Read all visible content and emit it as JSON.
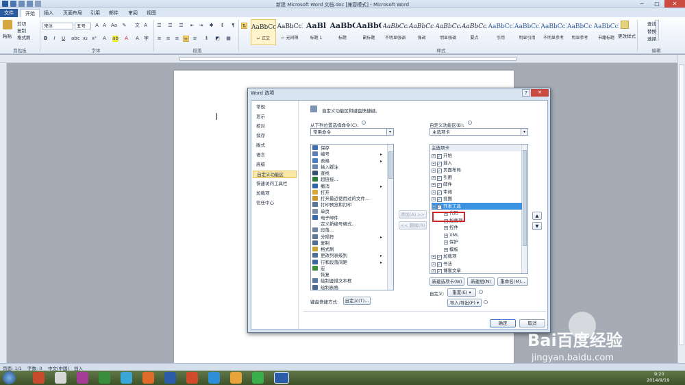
{
  "window": {
    "title": "新建 Microsoft Word 文档.doc [兼容模式] - Microsoft Word"
  },
  "tabs": [
    "文件",
    "开始",
    "插入",
    "页面布局",
    "引用",
    "邮件",
    "审阅",
    "视图"
  ],
  "ribbon": {
    "clipboard": {
      "paste": "粘贴",
      "cut": "剪切",
      "copy": "复制",
      "format_painter": "格式刷",
      "label": "剪贴板"
    },
    "font": {
      "name": "宋体",
      "size": "五号",
      "label": "字体"
    },
    "paragraph": {
      "label": "段落"
    },
    "styles": {
      "label": "样式",
      "items": [
        {
          "sample": "AaBbCcDc",
          "name": "↵ 正文"
        },
        {
          "sample": "AaBbCcDc",
          "name": "↵ 无间隔"
        },
        {
          "sample": "AaBl",
          "name": "标题 1"
        },
        {
          "sample": "AaBbC",
          "name": "标题"
        },
        {
          "sample": "AaBbC",
          "name": "副标题"
        },
        {
          "sample": "AaBbCcDc",
          "name": "不明显强调"
        },
        {
          "sample": "AaBbCcDc",
          "name": "强调"
        },
        {
          "sample": "AaBbCcDc",
          "name": "明显强调"
        },
        {
          "sample": "AaBbCcDc",
          "name": "要点"
        },
        {
          "sample": "AaBbCcDc",
          "name": "引用"
        },
        {
          "sample": "AaBbCcDc",
          "name": "明显引用"
        },
        {
          "sample": "AaBbCcDc",
          "name": "不明显参考"
        },
        {
          "sample": "AaBbCcDc",
          "name": "明显参考"
        },
        {
          "sample": "AaBbCcI",
          "name": "书籍标题"
        }
      ],
      "change_styles": "更改样式"
    },
    "editing": {
      "find": "查找",
      "replace": "替换",
      "select": "选择",
      "label": "编辑"
    }
  },
  "dialog": {
    "title": "Word 选项",
    "help": "?",
    "close": "✕",
    "nav": [
      "常规",
      "显示",
      "校对",
      "保存",
      "版式",
      "语言",
      "高级",
      "自定义功能区",
      "快速访问工具栏",
      "加载项",
      "信任中心"
    ],
    "header": "自定义功能区和键盘快捷键。",
    "left_label": "从下列位置选择命令(C):",
    "left_dropdown": "常用命令",
    "commands": [
      {
        "label": "保存",
        "color": "#3e6db0",
        "sub": ""
      },
      {
        "label": "编号",
        "color": "#5b7fb4",
        "sub": "▸"
      },
      {
        "label": "表格",
        "color": "#4a7cc0",
        "sub": "▸"
      },
      {
        "label": "插入脚注",
        "color": "#6a86ad",
        "sub": ""
      },
      {
        "label": "查找",
        "color": "#37506f",
        "sub": ""
      },
      {
        "label": "超链接...",
        "color": "#2d7a3c",
        "sub": ""
      },
      {
        "label": "撤消",
        "color": "#2f61a7",
        "sub": "▸"
      },
      {
        "label": "打开",
        "color": "#d6a93c",
        "sub": ""
      },
      {
        "label": "打开最近使用过的文件...",
        "color": "#c9972e",
        "sub": ""
      },
      {
        "label": "打印预览和打印",
        "color": "#5b7594",
        "sub": ""
      },
      {
        "label": "单页",
        "color": "#7a8ea6",
        "sub": ""
      },
      {
        "label": "电子邮件",
        "color": "#3b6aa8",
        "sub": ""
      },
      {
        "label": "定义新编号格式...",
        "color": "#ffffff",
        "sub": ""
      },
      {
        "label": "段落...",
        "color": "#6f85a0",
        "sub": ""
      },
      {
        "label": "分隔符",
        "color": "#5e7792",
        "sub": "▸"
      },
      {
        "label": "复制",
        "color": "#4f6c93",
        "sub": ""
      },
      {
        "label": "格式刷",
        "color": "#c8a435",
        "sub": ""
      },
      {
        "label": "更改列表级别",
        "color": "#4e6d97",
        "sub": "▸"
      },
      {
        "label": "行和段落间距",
        "color": "#3f65a0",
        "sub": "▸"
      },
      {
        "label": "宏",
        "color": "#3f8c3a",
        "sub": ""
      },
      {
        "label": "恢复",
        "color": "#ffffff",
        "sub": ""
      },
      {
        "label": "绘制竖排文本框",
        "color": "#5c79a2",
        "sub": ""
      },
      {
        "label": "绘制表格",
        "color": "#4d6b92",
        "sub": ""
      }
    ],
    "add_button": "添加(A) >>",
    "remove_button": "<< 删除(R)",
    "right_label": "自定义功能区(B):",
    "right_dropdown": "主选项卡",
    "tree_header": "主选项卡",
    "tree": [
      {
        "label": "开始",
        "level": 0,
        "checked": true,
        "toggle": "+"
      },
      {
        "label": "插入",
        "level": 0,
        "checked": true,
        "toggle": "+"
      },
      {
        "label": "页面布局",
        "level": 0,
        "checked": true,
        "toggle": "+"
      },
      {
        "label": "引用",
        "level": 0,
        "checked": true,
        "toggle": "+"
      },
      {
        "label": "邮件",
        "level": 0,
        "checked": true,
        "toggle": "+"
      },
      {
        "label": "审阅",
        "level": 0,
        "checked": true,
        "toggle": "+"
      },
      {
        "label": "视图",
        "level": 0,
        "checked": true,
        "toggle": "+"
      },
      {
        "label": "开发工具",
        "level": 0,
        "checked": true,
        "toggle": "−",
        "selected": true
      },
      {
        "label": "代码",
        "level": 1,
        "checked": false,
        "toggle": "+"
      },
      {
        "label": "加载项",
        "level": 1,
        "checked": false,
        "toggle": "+"
      },
      {
        "label": "控件",
        "level": 1,
        "checked": false,
        "toggle": "+"
      },
      {
        "label": "XML",
        "level": 1,
        "checked": false,
        "toggle": "+"
      },
      {
        "label": "保护",
        "level": 1,
        "checked": false,
        "toggle": "+"
      },
      {
        "label": "模板",
        "level": 1,
        "checked": false,
        "toggle": "+"
      },
      {
        "label": "加载项",
        "level": 0,
        "checked": true,
        "toggle": "+"
      },
      {
        "label": "书法",
        "level": 0,
        "checked": true,
        "toggle": "+"
      },
      {
        "label": "博客文章",
        "level": 0,
        "checked": true,
        "toggle": "+"
      }
    ],
    "new_tab_button": "新建选项卡(W)",
    "new_group_button": "新建组(N)",
    "rename_button": "重命名(M)...",
    "customize_label": "自定义:",
    "reset_button": "重置(E) ▾",
    "import_export_button": "导入/导出(P) ▾",
    "keyboard_label": "键盘快捷方式:",
    "customize_button": "自定义(T)...",
    "ok_button": "确定",
    "cancel_button": "取消"
  },
  "statusbar": {
    "page": "页面: 1/1",
    "words": "字数: 0",
    "language": "中文(中国)",
    "insert": "插入"
  },
  "taskbar": {
    "time": "9:20",
    "date": "2014/9/19"
  },
  "watermark": {
    "brand": "Bai百度经验",
    "url": "jingyan.baidu.com"
  }
}
